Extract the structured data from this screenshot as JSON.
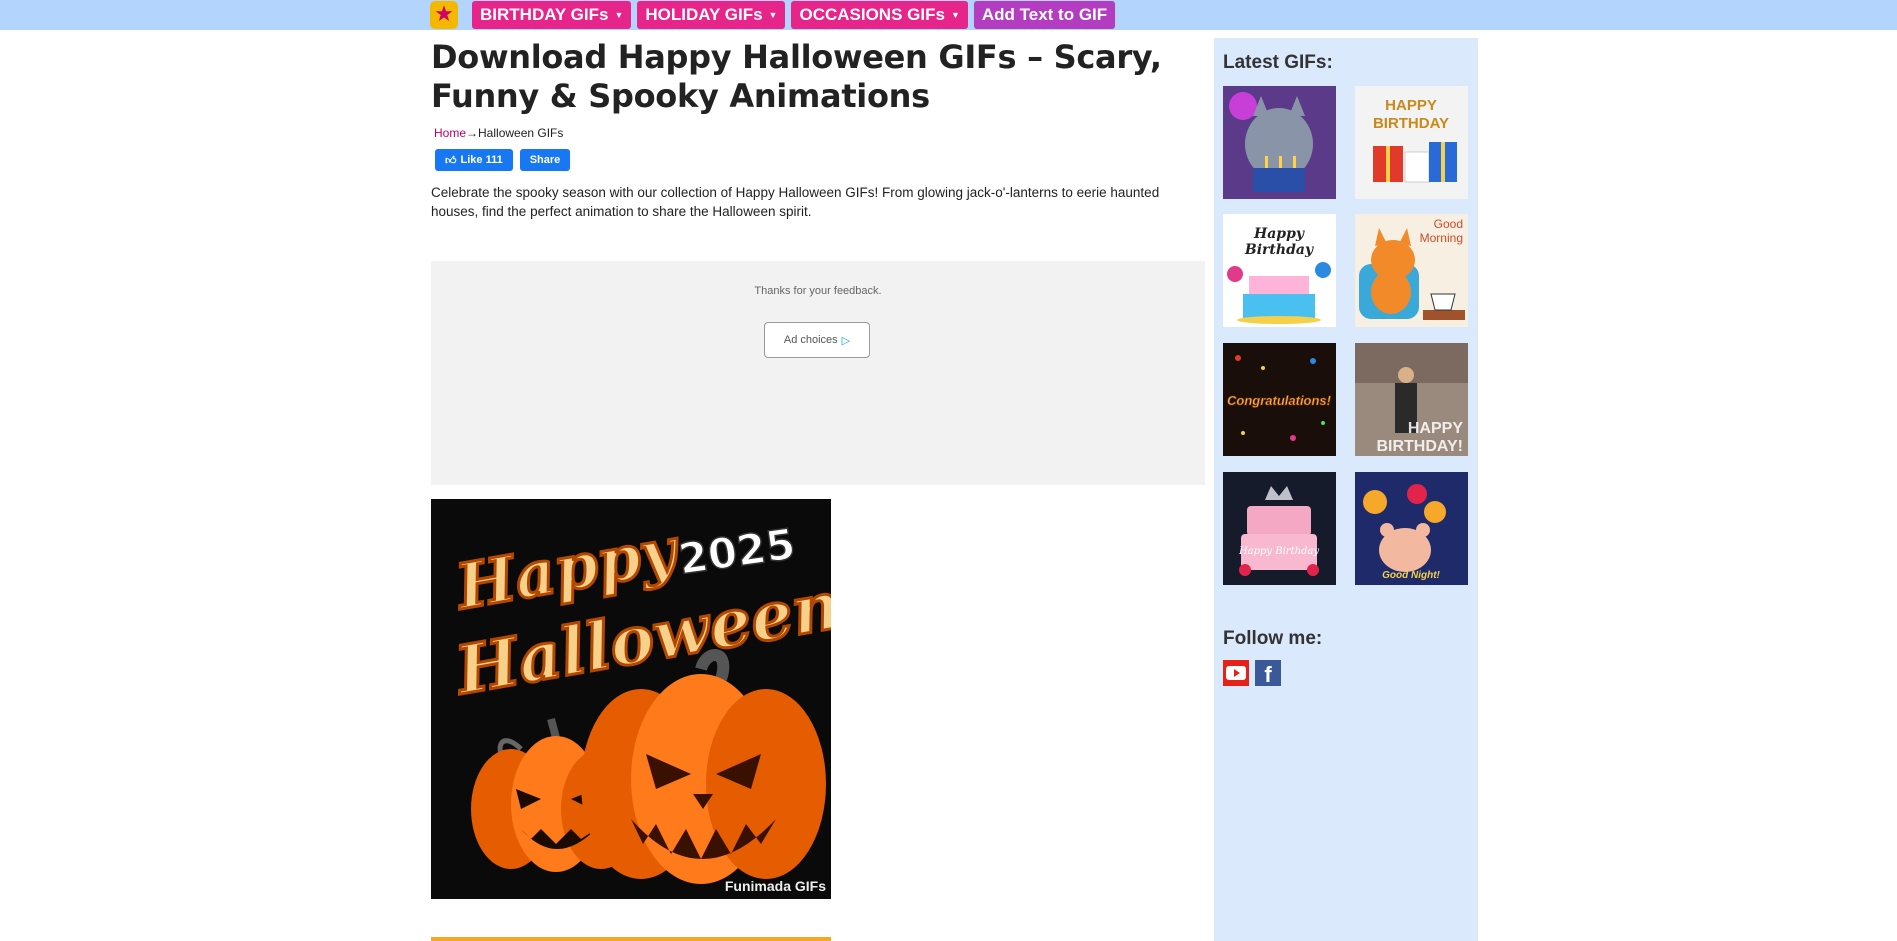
{
  "nav": {
    "logo_icon": "star-icon",
    "items": [
      {
        "label": "BIRTHDAY GIFs",
        "dropdown": true
      },
      {
        "label": "HOLIDAY GIFs",
        "dropdown": true
      },
      {
        "label": "OCCASIONS GIFs",
        "dropdown": true
      },
      {
        "label": "Add Text to GIF",
        "dropdown": false
      }
    ]
  },
  "page": {
    "title": "Download Happy Halloween GIFs – Scary, Funny & Spooky Animations",
    "breadcrumb": {
      "home": "Home",
      "separator": "→",
      "current": "Halloween GIFs"
    },
    "social": {
      "like_label": "Like 111",
      "share_label": "Share"
    },
    "description": "Celebrate the spooky season with our collection of Happy Halloween GIFs! From glowing jack-o'-lanterns to eerie haunted houses, find the perfect animation to share the Halloween spirit."
  },
  "ad": {
    "thanks": "Thanks for your feedback.",
    "choices_label": "Ad choices"
  },
  "hero": {
    "line1": "Happy",
    "year": "2025",
    "line2": "Halloween",
    "watermark": "Funimada GIFs"
  },
  "sidebar": {
    "latest_title": "Latest GIFs:",
    "thumbs": [
      {
        "name": "birthday-cat-cake"
      },
      {
        "name": "happy-birthday-gifts",
        "text1": "HAPPY",
        "text2": "BIRTHDAY"
      },
      {
        "name": "happy-birthday-cake",
        "text1": "Happy",
        "text2": "Birthday"
      },
      {
        "name": "good-morning-cat",
        "text1": "Good",
        "text2": "Morning"
      },
      {
        "name": "congratulations",
        "text1": "Congratulations!"
      },
      {
        "name": "happy-birthday-dance",
        "text1": "HAPPY",
        "text2": "BIRTHDAY!"
      },
      {
        "name": "happy-birthday-pink-cake",
        "text1": "Happy Birthday"
      },
      {
        "name": "good-night-bear",
        "text1": "Good Night!"
      }
    ],
    "follow_title": "Follow me:",
    "follow_icons": [
      "youtube-icon",
      "facebook-icon"
    ]
  },
  "colors": {
    "topbar": "#b3d4fd",
    "nav_pink": "#e6248a",
    "nav_purple": "#b43cc0",
    "sidebar_bg": "#dbe9fd",
    "link": "#c0006a",
    "facebook": "#1877f2"
  }
}
